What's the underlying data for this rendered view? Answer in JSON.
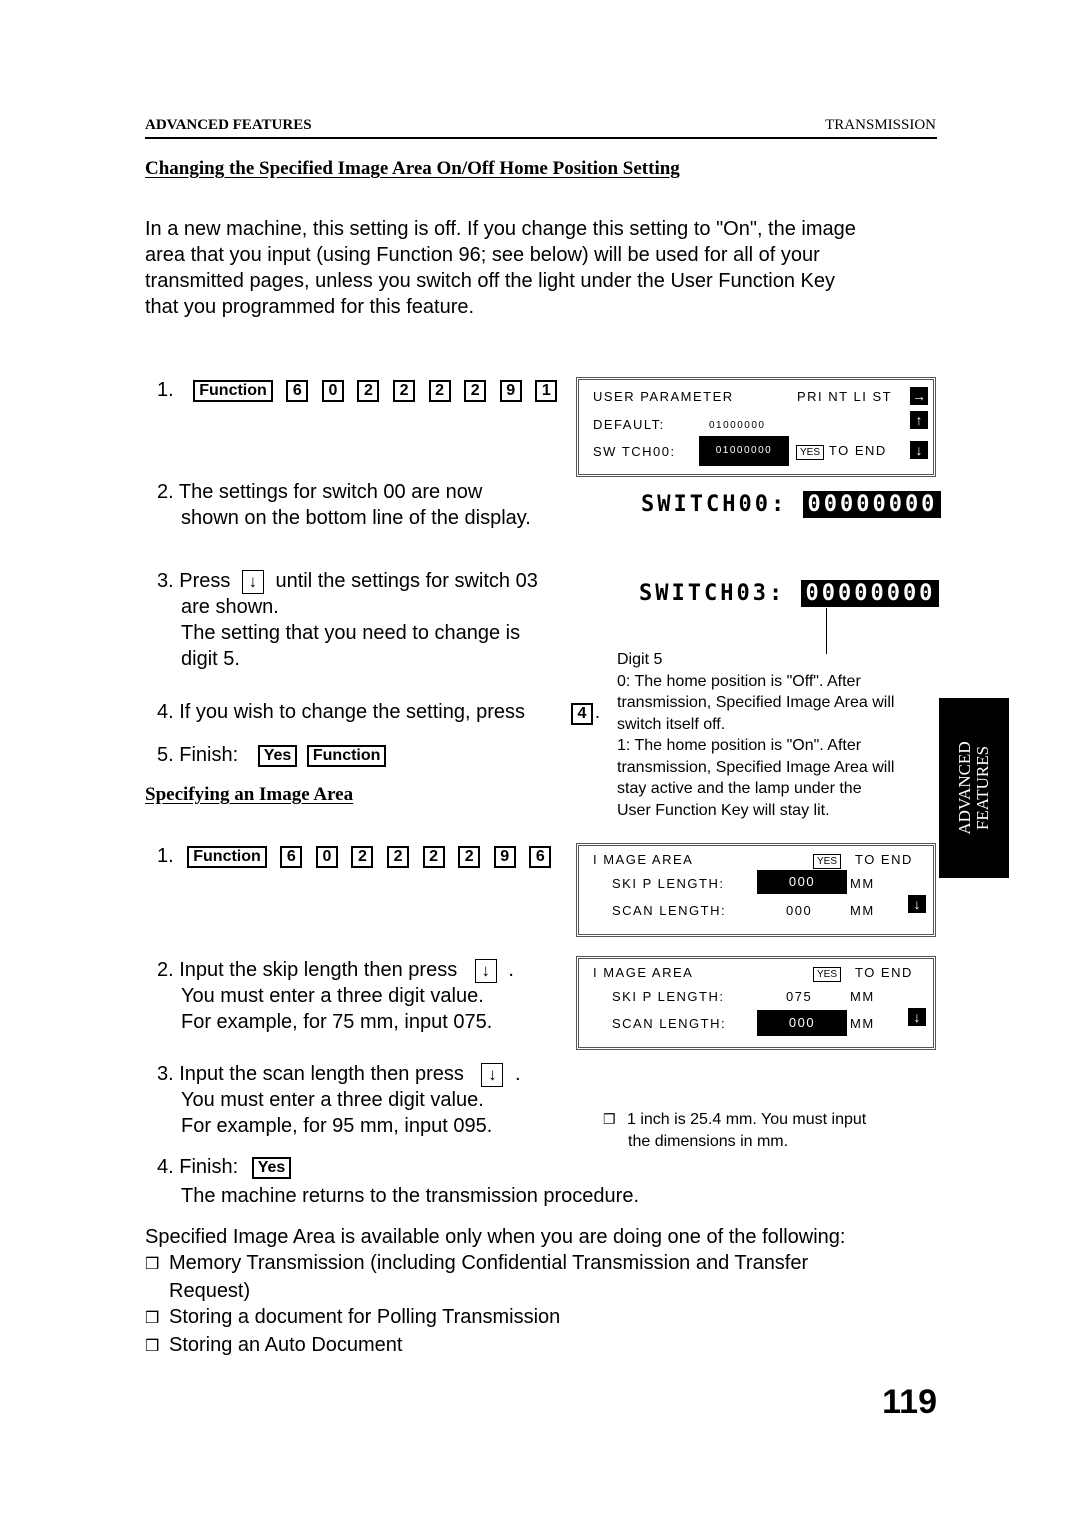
{
  "header": {
    "section": "ADVANCED FEATURES",
    "chapter": "TRANSMISSION"
  },
  "section1": {
    "title": "Changing the Specified Image Area On/Off Home Position Setting",
    "intro": [
      "In a new machine, this setting is off. If you change this setting to \"On\", the image",
      "area that you input (using Function 96; see below) will be used for all of your",
      "transmitted pages, unless you switch off the light under the User Function Key",
      "that you programmed for this feature."
    ],
    "step1": {
      "num": "1.",
      "function_key": "Function",
      "digits": [
        "6",
        "0",
        "2",
        "2",
        "2",
        "2",
        "9",
        "1"
      ]
    },
    "step2": {
      "line1": "2.  The settings for switch 00 are now",
      "line2": "shown on the bottom line of the display."
    },
    "step3": {
      "pre": "3. Press",
      "arrow": "↓",
      "post": "until the settings for switch 03",
      "line2": "are shown.",
      "line3": "The setting that you need to change is",
      "line4": "digit 5."
    },
    "step4": {
      "text": "4. If you wish to change the setting, press",
      "key": "4",
      "dot": "."
    },
    "step5": {
      "label": "5. Finish:",
      "keys": [
        "Yes",
        "Function"
      ]
    },
    "lcd": {
      "row1_left": "USER PARAMETER",
      "row1_right": "PRI NT LI ST",
      "row2_left": "DEFAULT:",
      "row2_value": "01000000",
      "row3_left": "SW TCH00:",
      "row3_value": "01000000",
      "yes": "YES",
      "to_end": "TO END",
      "icons": {
        "right": "→",
        "up": "↑",
        "down": "↓"
      }
    },
    "display_switch00": {
      "label": "SWITCH00:",
      "value": "00000000"
    },
    "display_switch03": {
      "label": "SWITCH03:",
      "value": "00000000"
    },
    "digit_note": [
      "Digit 5",
      "0: The home position is \"Off\". After",
      "transmission, Specified Image Area will",
      "switch itself off.",
      "1: The home position is \"On\". After",
      "transmission, Specified Image Area will",
      "stay active and the lamp under the",
      "User Function Key will stay lit."
    ]
  },
  "section2": {
    "title": "Specifying an Image Area",
    "step1": {
      "num": "1.",
      "function_key": "Function",
      "digits": [
        "6",
        "0",
        "2",
        "2",
        "2",
        "2",
        "9",
        "6"
      ]
    },
    "step2": {
      "pre": "2. Input the skip length then press",
      "arrow": "↓",
      "post": ".",
      "line2": "You must enter a three digit value.",
      "line3": "For example, for 75 mm, input 075."
    },
    "step3": {
      "pre": "3. Input the scan length then press",
      "arrow": "↓",
      "post": ".",
      "line2": "You must enter a three digit value.",
      "line3": "For example, for 95 mm, input 095."
    },
    "step4": {
      "label": "4. Finish:",
      "key": "Yes",
      "line2": "The machine returns to the transmission procedure."
    },
    "lcd1": {
      "title": "I MAGE AREA",
      "yes": "YES",
      "to_end": "TO END",
      "skip_label": "SKI P LENGTH:",
      "skip_value": "000",
      "scan_label": "SCAN LENGTH:",
      "scan_value": "000",
      "unit": "MM",
      "down": "↓"
    },
    "lcd2": {
      "title": "I MAGE AREA",
      "yes": "YES",
      "to_end": "TO END",
      "skip_label": "SKI P LENGTH:",
      "skip_value": "075",
      "scan_label": "SCAN LENGTH:",
      "scan_value": "000",
      "unit": "MM",
      "down": "↓"
    },
    "note": {
      "bullet": "❒",
      "line1": "1 inch is 25.4 mm. You must input",
      "line2": "the dimensions in mm."
    }
  },
  "availability": {
    "intro": "Specified Image Area is available only when you are doing one of the following:",
    "bullet": "❒",
    "items": [
      "Memory Transmission (including Confidential Transmission and Transfer",
      "Request)",
      "Storing a document for Polling Transmission",
      "Storing an Auto Document"
    ]
  },
  "side_tab": {
    "line1": "ADVANCED",
    "line2": "FEATURES"
  },
  "page_number": "119"
}
